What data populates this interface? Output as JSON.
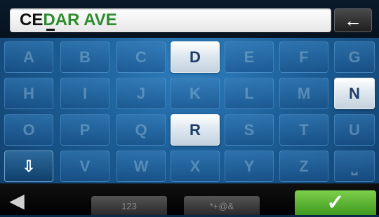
{
  "search": {
    "typed_text": "CE",
    "suggested_text": "DAR AVE",
    "backspace_glyph": "←"
  },
  "keyboard": {
    "rows": [
      [
        "A",
        "B",
        "C",
        "D",
        "E",
        "F",
        "G"
      ],
      [
        "H",
        "I",
        "J",
        "K",
        "L",
        "M",
        "N"
      ],
      [
        "O",
        "P",
        "Q",
        "R",
        "S",
        "T",
        "U"
      ],
      [
        "⇩",
        "V",
        "W",
        "X",
        "Y",
        "Z",
        "⎵"
      ]
    ],
    "active_keys": [
      "D",
      "N",
      "R"
    ],
    "dark_keys": [
      "⇩"
    ]
  },
  "bottom": {
    "back_glyph": "◀",
    "numbers_label": "123",
    "symbols_label": "*+@&",
    "confirm_glyph": "✓"
  },
  "colors": {
    "suggested_text": "#2e8b2e",
    "confirm": "#5db832"
  }
}
